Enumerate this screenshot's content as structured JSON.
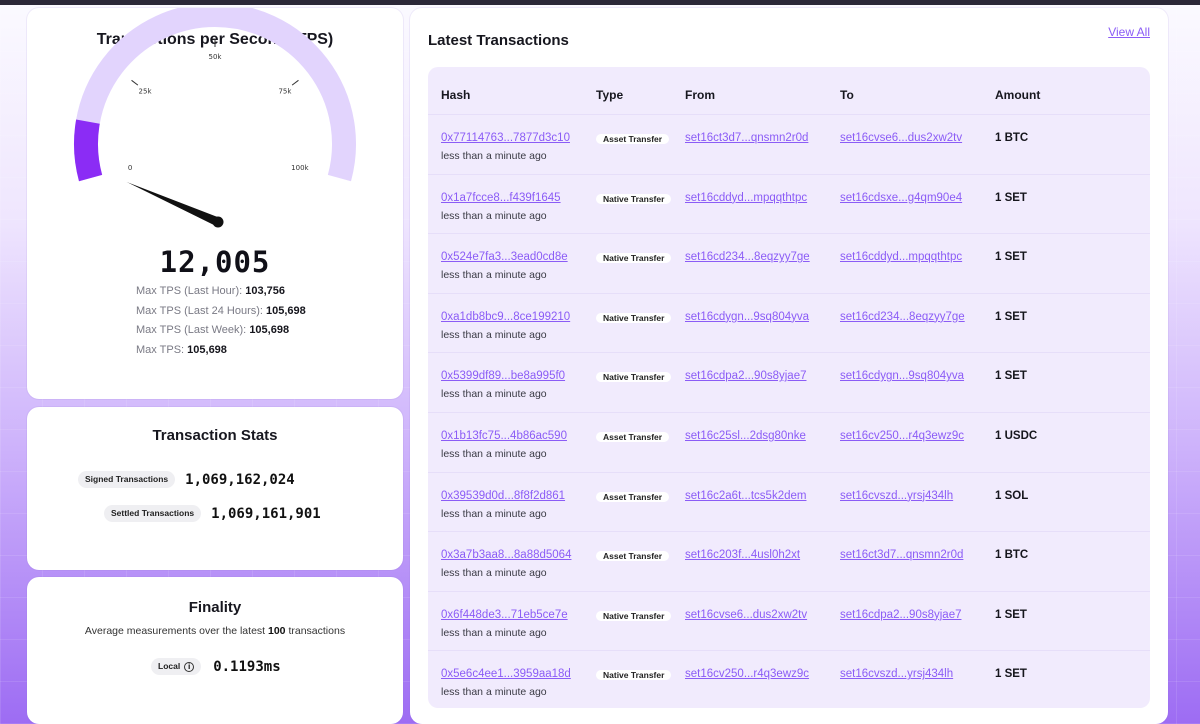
{
  "tps": {
    "title": "Transactions per Second (TPS)",
    "current_value": "12,005",
    "gauge_level": 12005,
    "gauge_max": 100000,
    "gauge_labels": [
      "0",
      "25k",
      "50k",
      "75k",
      "100k"
    ],
    "max_stats": [
      {
        "label": "Max TPS (Last Hour):",
        "value": "103,756"
      },
      {
        "label": "Max TPS (Last 24 Hours):",
        "value": "105,698"
      },
      {
        "label": "Max TPS (Last Week):",
        "value": "105,698"
      },
      {
        "label": "Max TPS:",
        "value": "105,698"
      }
    ],
    "colors": {
      "track": "#e2d4fd",
      "fill": "#8b2cf5",
      "needle": "#111111"
    }
  },
  "stats": {
    "title": "Transaction Stats",
    "signed_label": "Signed Transactions",
    "signed_value": "1,069,162,024",
    "settled_label": "Settled Transactions",
    "settled_value": "1,069,161,901"
  },
  "finality": {
    "title": "Finality",
    "subtitle_pre": "Average measurements over the latest",
    "subtitle_count": "100",
    "subtitle_post": "transactions",
    "local_label": "Local",
    "local_value": "0.1193ms",
    "info_icon": "info-icon"
  },
  "latest": {
    "title": "Latest Transactions",
    "view_all": "View All",
    "headers": [
      "Hash",
      "Type",
      "From",
      "To",
      "Amount"
    ],
    "rows": [
      {
        "hash": "0x77114763...7877d3c10",
        "time": "less than a minute ago",
        "type": "Asset Transfer",
        "from": "set16ct3d7...qnsmn2r0d",
        "to": "set16cvse6...dus2xw2tv",
        "amount": "1 BTC"
      },
      {
        "hash": "0x1a7fcce8...f439f1645",
        "time": "less than a minute ago",
        "type": "Native Transfer",
        "from": "set16cddyd...mpqqthtpc",
        "to": "set16cdsxe...g4qm90e4",
        "amount": "1 SET"
      },
      {
        "hash": "0x524e7fa3...3ead0cd8e",
        "time": "less than a minute ago",
        "type": "Native Transfer",
        "from": "set16cd234...8eqzyy7ge",
        "to": "set16cddyd...mpqqthtpc",
        "amount": "1 SET"
      },
      {
        "hash": "0xa1db8bc9...8ce199210",
        "time": "less than a minute ago",
        "type": "Native Transfer",
        "from": "set16cdygn...9sq804yva",
        "to": "set16cd234...8eqzyy7ge",
        "amount": "1 SET"
      },
      {
        "hash": "0x5399df89...be8a995f0",
        "time": "less than a minute ago",
        "type": "Native Transfer",
        "from": "set16cdpa2...90s8yjae7",
        "to": "set16cdygn...9sq804yva",
        "amount": "1 SET"
      },
      {
        "hash": "0x1b13fc75...4b86ac590",
        "time": "less than a minute ago",
        "type": "Asset Transfer",
        "from": "set16c25sl...2dsg80nke",
        "to": "set16cv250...r4q3ewz9c",
        "amount": "1 USDC"
      },
      {
        "hash": "0x39539d0d...8f8f2d861",
        "time": "less than a minute ago",
        "type": "Asset Transfer",
        "from": "set16c2a6t...tcs5k2dem",
        "to": "set16cvszd...yrsj434lh",
        "amount": "1 SOL"
      },
      {
        "hash": "0x3a7b3aa8...8a88d5064",
        "time": "less than a minute ago",
        "type": "Asset Transfer",
        "from": "set16c203f...4usl0h2xt",
        "to": "set16ct3d7...qnsmn2r0d",
        "amount": "1 BTC"
      },
      {
        "hash": "0x6f448de3...71eb5ce7e",
        "time": "less than a minute ago",
        "type": "Native Transfer",
        "from": "set16cvse6...dus2xw2tv",
        "to": "set16cdpa2...90s8yjae7",
        "amount": "1 SET"
      },
      {
        "hash": "0x5e6c4ee1...3959aa18d",
        "time": "less than a minute ago",
        "type": "Native Transfer",
        "from": "set16cv250...r4q3ewz9c",
        "to": "set16cvszd...yrsj434lh",
        "amount": "1 SET"
      }
    ]
  },
  "colors": {
    "accent": "#8b5cf6",
    "panel": "#f1ebfd"
  }
}
